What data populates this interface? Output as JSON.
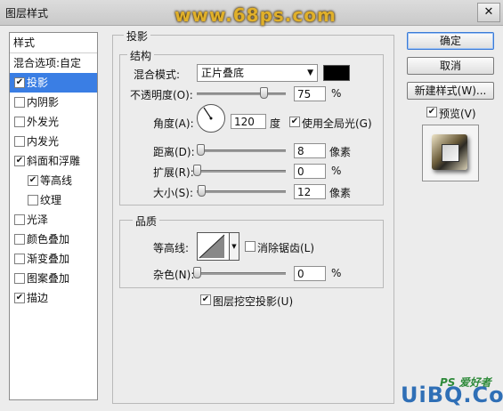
{
  "window": {
    "title": "图层样式",
    "close_glyph": "✕",
    "watermark": "www.68ps.com"
  },
  "sidebar": {
    "header": "样式",
    "items": [
      {
        "label": "混合选项:自定",
        "has_checkbox": false,
        "checked": false,
        "selected": false,
        "indent": false
      },
      {
        "label": "投影",
        "has_checkbox": true,
        "checked": true,
        "selected": true,
        "indent": false
      },
      {
        "label": "内阴影",
        "has_checkbox": true,
        "checked": false,
        "selected": false,
        "indent": false
      },
      {
        "label": "外发光",
        "has_checkbox": true,
        "checked": false,
        "selected": false,
        "indent": false
      },
      {
        "label": "内发光",
        "has_checkbox": true,
        "checked": false,
        "selected": false,
        "indent": false
      },
      {
        "label": "斜面和浮雕",
        "has_checkbox": true,
        "checked": true,
        "selected": false,
        "indent": false
      },
      {
        "label": "等高线",
        "has_checkbox": true,
        "checked": true,
        "selected": false,
        "indent": true
      },
      {
        "label": "纹理",
        "has_checkbox": true,
        "checked": false,
        "selected": false,
        "indent": true
      },
      {
        "label": "光泽",
        "has_checkbox": true,
        "checked": false,
        "selected": false,
        "indent": false
      },
      {
        "label": "颜色叠加",
        "has_checkbox": true,
        "checked": false,
        "selected": false,
        "indent": false
      },
      {
        "label": "渐变叠加",
        "has_checkbox": true,
        "checked": false,
        "selected": false,
        "indent": false
      },
      {
        "label": "图案叠加",
        "has_checkbox": true,
        "checked": false,
        "selected": false,
        "indent": false
      },
      {
        "label": "描边",
        "has_checkbox": true,
        "checked": true,
        "selected": false,
        "indent": false
      }
    ]
  },
  "panel": {
    "title": "投影",
    "structure": {
      "title": "结构",
      "blend_mode_label": "混合模式:",
      "blend_mode_value": "正片叠底",
      "shadow_color": "#000000",
      "opacity_label": "不透明度(O):",
      "opacity_value": "75",
      "opacity_unit": "%",
      "opacity_level": 0.75,
      "angle_label": "角度(A):",
      "angle_value": "120",
      "angle_unit": "度",
      "use_global_light_label": "使用全局光(G)",
      "use_global_light_checked": true,
      "distance_label": "距离(D):",
      "distance_value": "8",
      "distance_unit": "像素",
      "distance_level": 0.04,
      "spread_label": "扩展(R):",
      "spread_value": "0",
      "spread_unit": "%",
      "spread_level": 0.0,
      "size_label": "大小(S):",
      "size_value": "12",
      "size_unit": "像素",
      "size_level": 0.05
    },
    "quality": {
      "title": "品质",
      "contour_label": "等高线:",
      "anti_alias_label": "消除锯齿(L)",
      "anti_alias_checked": false,
      "noise_label": "杂色(N):",
      "noise_value": "0",
      "noise_unit": "%",
      "noise_level": 0.0
    },
    "knockout_label": "图层挖空投影(U)",
    "knockout_checked": true
  },
  "buttons": {
    "ok": "确定",
    "cancel": "取消",
    "new_style": "新建样式(W)...",
    "preview_label": "预览(V)",
    "preview_checked": true
  },
  "footer_watermark": {
    "brand": "UiBQ.CoM",
    "small": "PS 爱好者"
  }
}
